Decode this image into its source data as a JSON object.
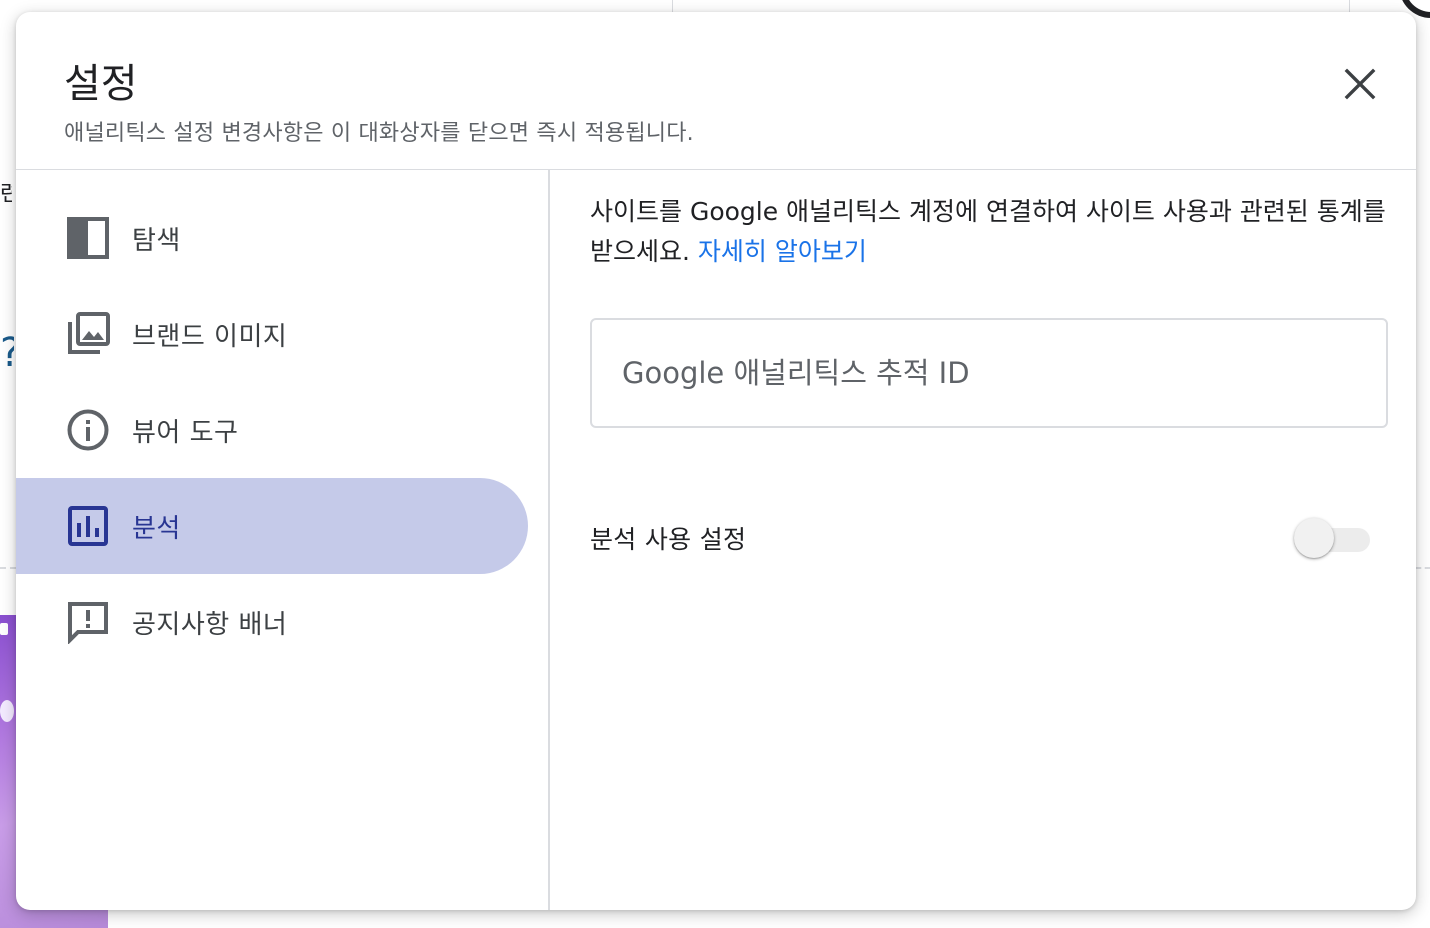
{
  "background": {
    "edge_text": "련",
    "edge_symbol": "?"
  },
  "dialog": {
    "title": "설정",
    "subtitle": "애널리틱스 설정 변경사항은 이 대화상자를 닫으면 즉시 적용됩니다.",
    "close_icon": "close-icon"
  },
  "sidebar": {
    "items": [
      {
        "label": "탐색",
        "icon": "navigation-panel-icon",
        "active": false
      },
      {
        "label": "브랜드 이미지",
        "icon": "photo-library-icon",
        "active": false
      },
      {
        "label": "뷰어 도구",
        "icon": "info-icon",
        "active": false
      },
      {
        "label": "분석",
        "icon": "bar-chart-icon",
        "active": true
      },
      {
        "label": "공지사항 배너",
        "icon": "feedback-icon",
        "active": false
      }
    ]
  },
  "analytics": {
    "description": "사이트를 Google 애널리틱스 계정에 연결하여 사이트 사용과 관련된 통계를 받으세요.",
    "learn_more": "자세히 알아보기",
    "tracking_id": {
      "value": "",
      "placeholder": "Google 애널리틱스 추적 ID"
    },
    "toggle_label": "분석 사용 설정",
    "toggle_enabled": false
  },
  "colors": {
    "active_nav_bg": "#c5cae9",
    "active_nav_fg": "#283593",
    "link": "#1a73e8",
    "divider": "#dadce0"
  }
}
